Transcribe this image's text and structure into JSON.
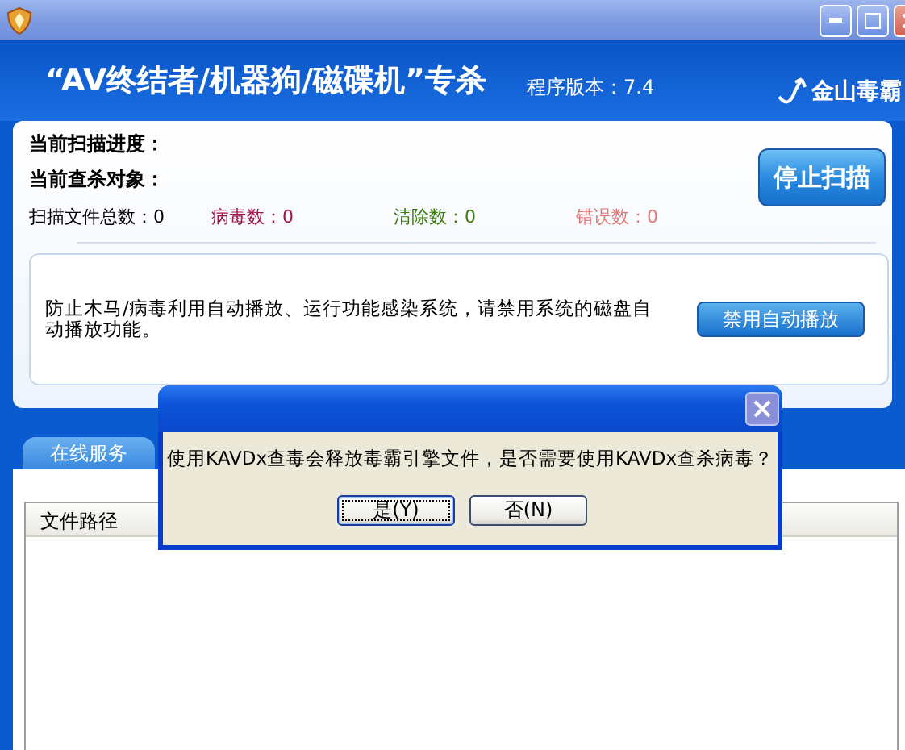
{
  "header": {
    "title": "“AV终结者/机器狗/磁碟机”专杀",
    "version": "程序版本：7.4",
    "logo": "金山毒霸"
  },
  "status": {
    "progress_label": "当前扫描进度：",
    "target_label": "当前查杀对象：",
    "stop_button": "停止扫描"
  },
  "counters": [
    {
      "label": "扫描文件总数：",
      "value": "0",
      "color": "#000000"
    },
    {
      "label": "病毒数：",
      "value": "0",
      "color": "#a0124a"
    },
    {
      "label": "清除数：",
      "value": "0",
      "color": "#3a7a10"
    },
    {
      "label": "错误数：",
      "value": "0",
      "color": "#e07878"
    }
  ],
  "autoplay": {
    "message": "防止木马/病毒利用自动播放、运行功能感染系统，请禁用系统的磁盘自动播放功能。",
    "button": "禁用自动播放"
  },
  "tabs": [
    {
      "label": "在线服务",
      "selected": true
    }
  ],
  "table": {
    "columns": [
      "文件路径"
    ]
  },
  "dialog": {
    "message": "使用KAVDx查毒会释放毒霸引擎文件，是否需要使用KAVDx查杀病毒？",
    "buttons": [
      {
        "label": "是(Y)",
        "selected": true
      },
      {
        "label": "否(N)",
        "selected": false
      }
    ]
  }
}
